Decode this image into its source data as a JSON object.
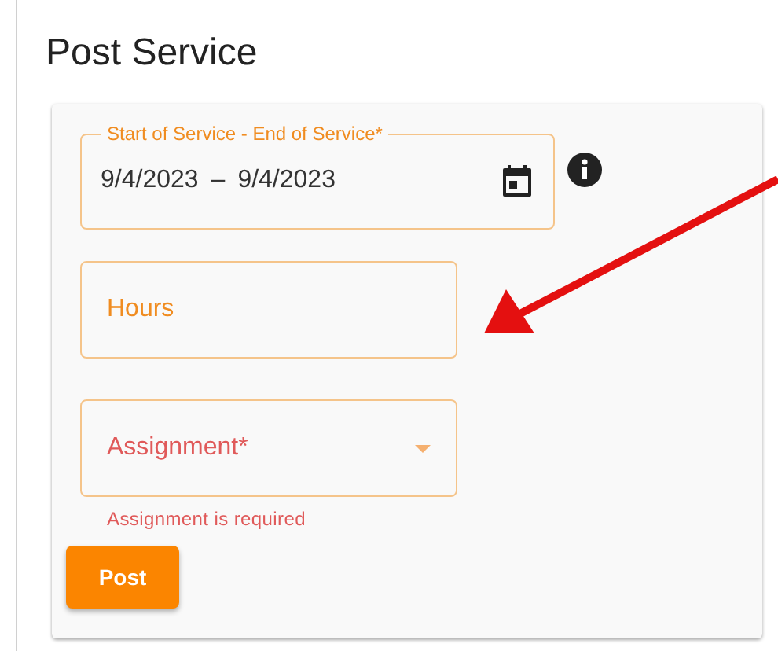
{
  "title": "Post Service",
  "date_range": {
    "label": "Start of Service - End of Service*",
    "start": "9/4/2023",
    "separator": "–",
    "end": "9/4/2023"
  },
  "hours": {
    "placeholder": "Hours",
    "invalid": false
  },
  "assignment": {
    "label": "Assignment*",
    "invalid": true,
    "error": "Assignment is required"
  },
  "buttons": [
    "Post"
  ]
}
